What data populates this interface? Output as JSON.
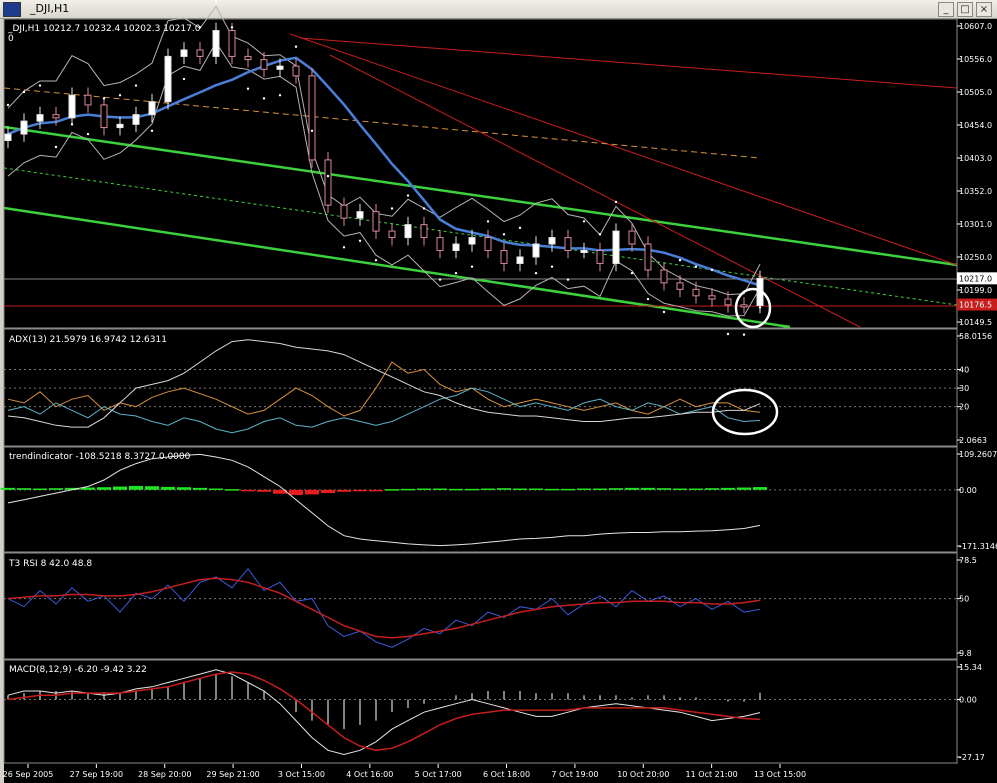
{
  "window": {
    "title": "_DJI,H1",
    "buttons": [
      "_",
      "□",
      "×"
    ]
  },
  "chart_data": [
    {
      "type": "candlestick",
      "title": "_DJI,H1",
      "ohlc": "10212.7 10232.4 10202.3 10217.0",
      "corner": "0",
      "y_ticks": [
        "10607.0",
        "10556.0",
        "10505.0",
        "10454.0",
        "10403.0",
        "10352.0",
        "10301.0",
        "10250.0",
        "10199.0",
        "10149.5"
      ],
      "ylim": [
        10149.5,
        10607.0
      ],
      "current_price": "10217.0",
      "red_marker_price": "10176.5",
      "annotation": "white circle around last candles",
      "closes": [
        10440,
        10460,
        10470,
        10465,
        10500,
        10485,
        10450,
        10455,
        10470,
        10490,
        10560,
        10570,
        10560,
        10600,
        10560,
        10555,
        10540,
        10545,
        10530,
        10400,
        10330,
        10310,
        10320,
        10290,
        10280,
        10300,
        10280,
        10260,
        10270,
        10280,
        10260,
        10240,
        10250,
        10270,
        10280,
        10260,
        10260,
        10240,
        10290,
        10270,
        10230,
        10210,
        10200,
        10190,
        10185,
        10176,
        10175,
        10217
      ]
    },
    {
      "type": "line",
      "title": "ADX(13) 21.5979 16.9742 12.6311",
      "y_ticks": [
        "58.0156",
        "40",
        "30",
        "20",
        "2.0663"
      ],
      "ylim": [
        2.0663,
        58.0156
      ],
      "levels": [
        40,
        30,
        20
      ],
      "series": [
        {
          "name": "ADX",
          "values": [
            15,
            14,
            12,
            10,
            9,
            9,
            14,
            22,
            30,
            32,
            34,
            38,
            44,
            50,
            55,
            56,
            55,
            54,
            52,
            51,
            50,
            48,
            44,
            40,
            36,
            32,
            28,
            26,
            22,
            19,
            17,
            16,
            15,
            15,
            14,
            13,
            12,
            12,
            13,
            14,
            14,
            15,
            16,
            17,
            17,
            18,
            18,
            21.6
          ]
        },
        {
          "name": "+DI",
          "values": [
            24,
            22,
            28,
            20,
            24,
            26,
            18,
            22,
            20,
            25,
            28,
            30,
            27,
            24,
            20,
            16,
            18,
            24,
            30,
            26,
            20,
            15,
            18,
            30,
            44,
            38,
            40,
            32,
            28,
            30,
            24,
            20,
            22,
            24,
            22,
            20,
            18,
            20,
            22,
            18,
            16,
            20,
            24,
            20,
            22,
            22,
            18,
            17
          ]
        },
        {
          "name": "-DI",
          "values": [
            18,
            20,
            16,
            22,
            18,
            14,
            20,
            16,
            15,
            12,
            10,
            14,
            12,
            8,
            6,
            8,
            12,
            14,
            10,
            9,
            12,
            14,
            12,
            10,
            12,
            16,
            20,
            24,
            26,
            30,
            28,
            24,
            20,
            22,
            20,
            18,
            22,
            24,
            20,
            18,
            22,
            20,
            16,
            18,
            20,
            14,
            12,
            12.6
          ]
        }
      ]
    },
    {
      "type": "line",
      "title": "trendindicator -108.5218 8.3727 0.0000",
      "y_ticks": [
        "109.2607",
        "0.00",
        "-171.3146"
      ],
      "ylim": [
        -171.3146,
        109.2607
      ],
      "series": [
        {
          "name": "line",
          "values": [
            -40,
            -30,
            -20,
            -10,
            0,
            10,
            30,
            60,
            80,
            95,
            100,
            105,
            108,
            100,
            90,
            70,
            40,
            10,
            -30,
            -70,
            -110,
            -140,
            -150,
            -155,
            -160,
            -165,
            -168,
            -170,
            -168,
            -165,
            -160,
            -155,
            -150,
            -148,
            -145,
            -140,
            -140,
            -135,
            -132,
            -130,
            -130,
            -128,
            -128,
            -126,
            -125,
            -122,
            -118,
            -108.5
          ]
        },
        {
          "name": "histogram",
          "values": [
            6,
            5,
            4,
            5,
            6,
            7,
            8,
            10,
            12,
            11,
            9,
            8,
            6,
            4,
            2,
            -2,
            -6,
            -12,
            -16,
            -14,
            -10,
            -6,
            -4,
            -2,
            2,
            3,
            4,
            4,
            3,
            3,
            4,
            5,
            4,
            4,
            3,
            3,
            4,
            4,
            5,
            6,
            6,
            5,
            4,
            4,
            5,
            6,
            7,
            8.4
          ]
        }
      ]
    },
    {
      "type": "line",
      "title": "T3 RSI 8 42.0 48.8",
      "y_ticks": [
        "78.5",
        "50",
        "9.8"
      ],
      "ylim": [
        9.8,
        78.5
      ],
      "levels": [
        50
      ],
      "series": [
        {
          "name": "RSI",
          "values": [
            50,
            44,
            56,
            46,
            58,
            48,
            52,
            40,
            54,
            50,
            60,
            48,
            62,
            66,
            58,
            72,
            56,
            62,
            48,
            50,
            30,
            22,
            26,
            18,
            14,
            20,
            28,
            24,
            34,
            30,
            40,
            36,
            44,
            42,
            50,
            38,
            46,
            52,
            44,
            56,
            48,
            52,
            44,
            50,
            42,
            48,
            40,
            42
          ]
        },
        {
          "name": "T3",
          "values": [
            50,
            51,
            52,
            52,
            53,
            53,
            52,
            52,
            53,
            55,
            58,
            61,
            64,
            65,
            64,
            62,
            58,
            54,
            48,
            42,
            36,
            30,
            26,
            22,
            21,
            22,
            24,
            26,
            28,
            31,
            34,
            37,
            40,
            42,
            44,
            45,
            46,
            47,
            47,
            48,
            48,
            48,
            47,
            47,
            46,
            46,
            47,
            48.8
          ]
        }
      ]
    },
    {
      "type": "bar",
      "title": "MACD(8,12,9) -6.20 -9.42 3.22",
      "y_ticks": [
        "15.34",
        "0.00",
        "-27.17"
      ],
      "ylim": [
        -27.17,
        15.34
      ],
      "series": [
        {
          "name": "MACD histogram",
          "values": [
            2,
            3,
            4,
            4,
            4,
            3,
            3,
            3,
            4,
            5,
            6,
            8,
            10,
            12,
            11,
            8,
            4,
            0,
            -6,
            -10,
            -12,
            -14,
            -12,
            -10,
            -6,
            -4,
            -2,
            0,
            2,
            3,
            4,
            4,
            4,
            3,
            3,
            3,
            2,
            2,
            2,
            1,
            2,
            2,
            1,
            1,
            0,
            -1,
            -1,
            3.2
          ]
        },
        {
          "name": "MACD",
          "values": [
            2,
            4,
            4,
            3,
            4,
            3,
            2,
            3,
            5,
            6,
            8,
            10,
            12,
            14,
            12,
            8,
            4,
            -2,
            -10,
            -18,
            -24,
            -26,
            -24,
            -20,
            -14,
            -10,
            -6,
            -4,
            -2,
            0,
            -2,
            -4,
            -6,
            -8,
            -8,
            -6,
            -4,
            -3,
            -2,
            -3,
            -4,
            -5,
            -6,
            -8,
            -10,
            -9,
            -8,
            -6.2
          ]
        },
        {
          "name": "Signal",
          "values": [
            0,
            1,
            2,
            2,
            3,
            3,
            3,
            3,
            4,
            5,
            6,
            8,
            10,
            12,
            13,
            12,
            9,
            5,
            0,
            -6,
            -12,
            -18,
            -22,
            -24,
            -23,
            -20,
            -16,
            -12,
            -9,
            -7,
            -6,
            -5,
            -5,
            -5,
            -5,
            -5,
            -4,
            -4,
            -4,
            -4,
            -4,
            -4,
            -5,
            -6,
            -7,
            -8,
            -9,
            -9.4
          ]
        }
      ]
    }
  ],
  "time_labels": [
    "26 Sep 2005",
    "27 Sep 19:00",
    "28 Sep 20:00",
    "29 Sep 21:00",
    "3 Oct 15:00",
    "4 Oct 16:00",
    "5 Oct 17:00",
    "6 Oct 18:00",
    "7 Oct 19:00",
    "10 Oct 20:00",
    "11 Oct 21:00",
    "13 Oct 15:00"
  ],
  "colors": {
    "background": "#000000",
    "grid": "#5a5a5a",
    "green_channel": "#3cd23c",
    "red_lines": "#c81e1e",
    "ma_blue": "#4a7fd8",
    "rsi_blue": "#3c5adc",
    "adx_white": "#d8d8d8",
    "adx_orange": "#d8923c",
    "adx_cyan": "#5ab4c8",
    "hist_green": "#1ee61e",
    "hist_red": "#e61e1e"
  }
}
